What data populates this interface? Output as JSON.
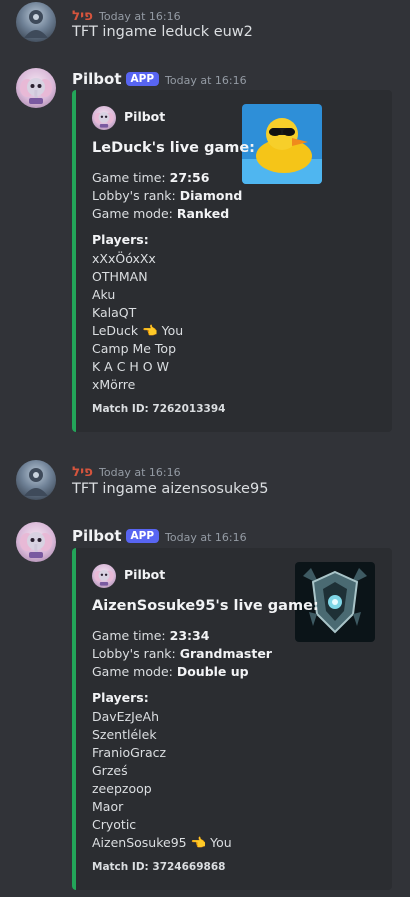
{
  "messages": [
    {
      "author": "פיל",
      "timestamp": "Today at 16:16",
      "text": "TFT ingame leduck euw2"
    },
    {
      "author": "Pilbot",
      "badge": "APP",
      "timestamp": "Today at 16:16",
      "embed": {
        "author": "Pilbot",
        "title": "LeDuck's live game:",
        "fields": [
          {
            "label": "Game time: ",
            "value": "27:56"
          },
          {
            "label": "Lobby's rank: ",
            "value": "Diamond"
          },
          {
            "label": "Game mode: ",
            "value": "Ranked"
          }
        ],
        "players_heading": "Players:",
        "players": [
          "xXxÖóxXx",
          "OTHMAN",
          "Aku",
          "KalaQT",
          "LeDuck 👈 You",
          "Camp Me Top",
          "K A C H O W",
          "xMörre"
        ],
        "match_id": "Match ID: 7262013394",
        "accent": "#23a559"
      }
    },
    {
      "author": "פיל",
      "timestamp": "Today at 16:16",
      "text": "TFT ingame aizensosuke95"
    },
    {
      "author": "Pilbot",
      "badge": "APP",
      "timestamp": "Today at 16:16",
      "embed": {
        "author": "Pilbot",
        "title": "AizenSosuke95's live game:",
        "fields": [
          {
            "label": "Game time: ",
            "value": "23:34"
          },
          {
            "label": "Lobby's rank: ",
            "value": "Grandmaster"
          },
          {
            "label": "Game mode: ",
            "value": "Double up"
          }
        ],
        "players_heading": "Players:",
        "players": [
          "DavEzJeAh",
          "Szentlélek",
          "FranioGracz",
          "Grześ",
          "zeepzoop",
          "Maor",
          "Cryotic",
          "AizenSosuke95 👈 You"
        ],
        "match_id": "Match ID: 3724669868",
        "accent": "#23a559"
      }
    }
  ],
  "icons": {
    "user_avatar": "user-avatar-icon",
    "bot_avatar": "elephant-bot-avatar-icon",
    "thumb_1": "rubber-duck-sunglasses-icon",
    "thumb_2": "grandmaster-emblem-icon"
  }
}
